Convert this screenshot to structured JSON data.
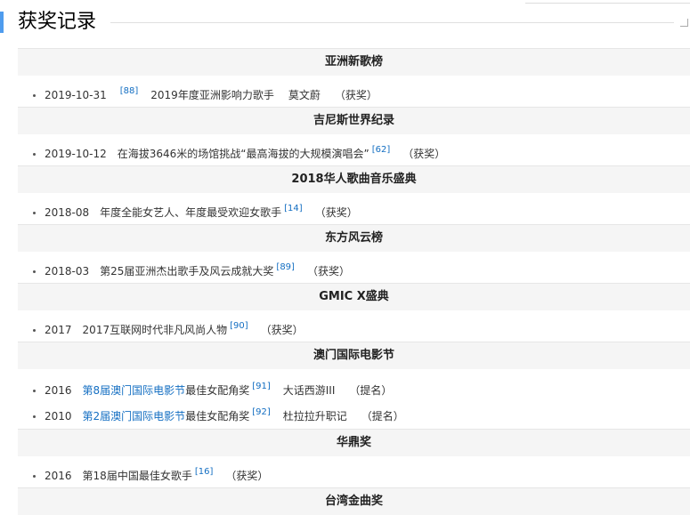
{
  "page_title": "获奖记录",
  "sections": [
    {
      "category": "亚洲新歌榜",
      "items": [
        {
          "date": "2019-10-31",
          "award_link": "",
          "award_text": "",
          "ref": "[88]",
          "award_after": "2019年度亚洲影响力歌手",
          "work": "莫文蔚",
          "status": "（获奖）"
        }
      ]
    },
    {
      "category": "吉尼斯世界纪录",
      "items": [
        {
          "date": "2019-10-12",
          "award_link": "",
          "award_text": "在海拔3646米的场馆挑战“最高海拔的大规模演唱会”",
          "ref": "[62]",
          "award_after": "",
          "work": "",
          "status": "（获奖）"
        }
      ]
    },
    {
      "category": "2018华人歌曲音乐盛典",
      "items": [
        {
          "date": "2018-08",
          "award_link": "",
          "award_text": "年度全能女艺人、年度最受欢迎女歌手",
          "ref": "[14]",
          "award_after": "",
          "work": "",
          "status": "（获奖）"
        }
      ]
    },
    {
      "category": "东方风云榜",
      "items": [
        {
          "date": "2018-03",
          "award_link": "",
          "award_text": "第25届亚洲杰出歌手及风云成就大奖",
          "ref": "[89]",
          "award_after": "",
          "work": "",
          "status": "（获奖）"
        }
      ]
    },
    {
      "category": "GMIC X盛典",
      "items": [
        {
          "date": "2017",
          "award_link": "",
          "award_text": "2017互联网时代非凡风尚人物",
          "ref": "[90]",
          "award_after": "",
          "work": "",
          "status": "（获奖）"
        }
      ]
    },
    {
      "category": "澳门国际电影节",
      "items": [
        {
          "date": "2016",
          "award_link": "第8届澳门国际电影节",
          "award_text": "最佳女配角奖",
          "ref": "[91]",
          "award_after": "",
          "work": "大话西游III",
          "status": "（提名）"
        },
        {
          "date": "2010",
          "award_link": "第2届澳门国际电影节",
          "award_text": "最佳女配角奖",
          "ref": "[92]",
          "award_after": "",
          "work": "杜拉拉升职记",
          "status": "（提名）"
        }
      ]
    },
    {
      "category": "华鼎奖",
      "items": [
        {
          "date": "2016",
          "award_link": "",
          "award_text": "第18届中国最佳女歌手",
          "ref": "[16]",
          "award_after": "",
          "work": "",
          "status": "（获奖）"
        }
      ]
    },
    {
      "category": "台湾金曲奖",
      "items": []
    }
  ]
}
